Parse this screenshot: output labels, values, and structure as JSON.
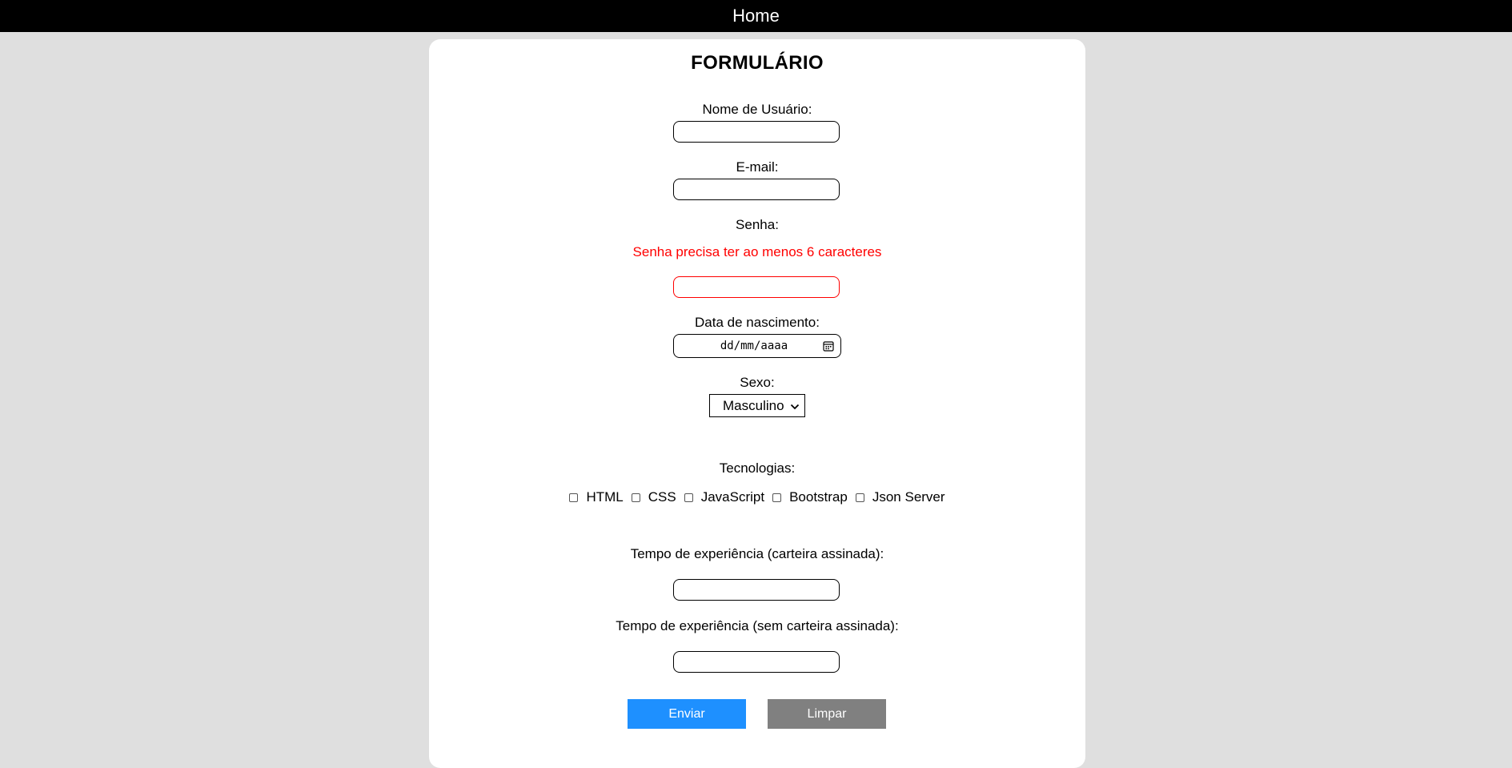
{
  "nav": {
    "home_label": "Home"
  },
  "form": {
    "title": "FORMULÁRIO",
    "username_label": "Nome de Usuário:",
    "username_value": "",
    "email_label": "E-mail:",
    "email_value": "",
    "password_label": "Senha:",
    "password_error": "Senha precisa ter ao menos 6 caracteres",
    "password_value": "",
    "birthdate_label": "Data de nascimento:",
    "birthdate_placeholder": "dd/mm/aaaa",
    "sex_label": "Sexo:",
    "sex_selected": "Masculino",
    "technologies_label": "Tecnologias:",
    "technologies": [
      {
        "label": "HTML",
        "checked": false
      },
      {
        "label": "CSS",
        "checked": false
      },
      {
        "label": "JavaScript",
        "checked": false
      },
      {
        "label": "Bootstrap",
        "checked": false
      },
      {
        "label": "Json Server",
        "checked": false
      }
    ],
    "exp_signed_label": "Tempo de experiência (carteira assinada):",
    "exp_signed_value": "",
    "exp_unsigned_label": "Tempo de experiência (sem carteira assinada):",
    "exp_unsigned_value": "",
    "submit_label": "Enviar",
    "reset_label": "Limpar"
  },
  "colors": {
    "page_bg": "#dfdfdf",
    "navbar_bg": "#000000",
    "error": "#ff0000",
    "submit_bg": "#1e90ff",
    "reset_bg": "#808080"
  }
}
